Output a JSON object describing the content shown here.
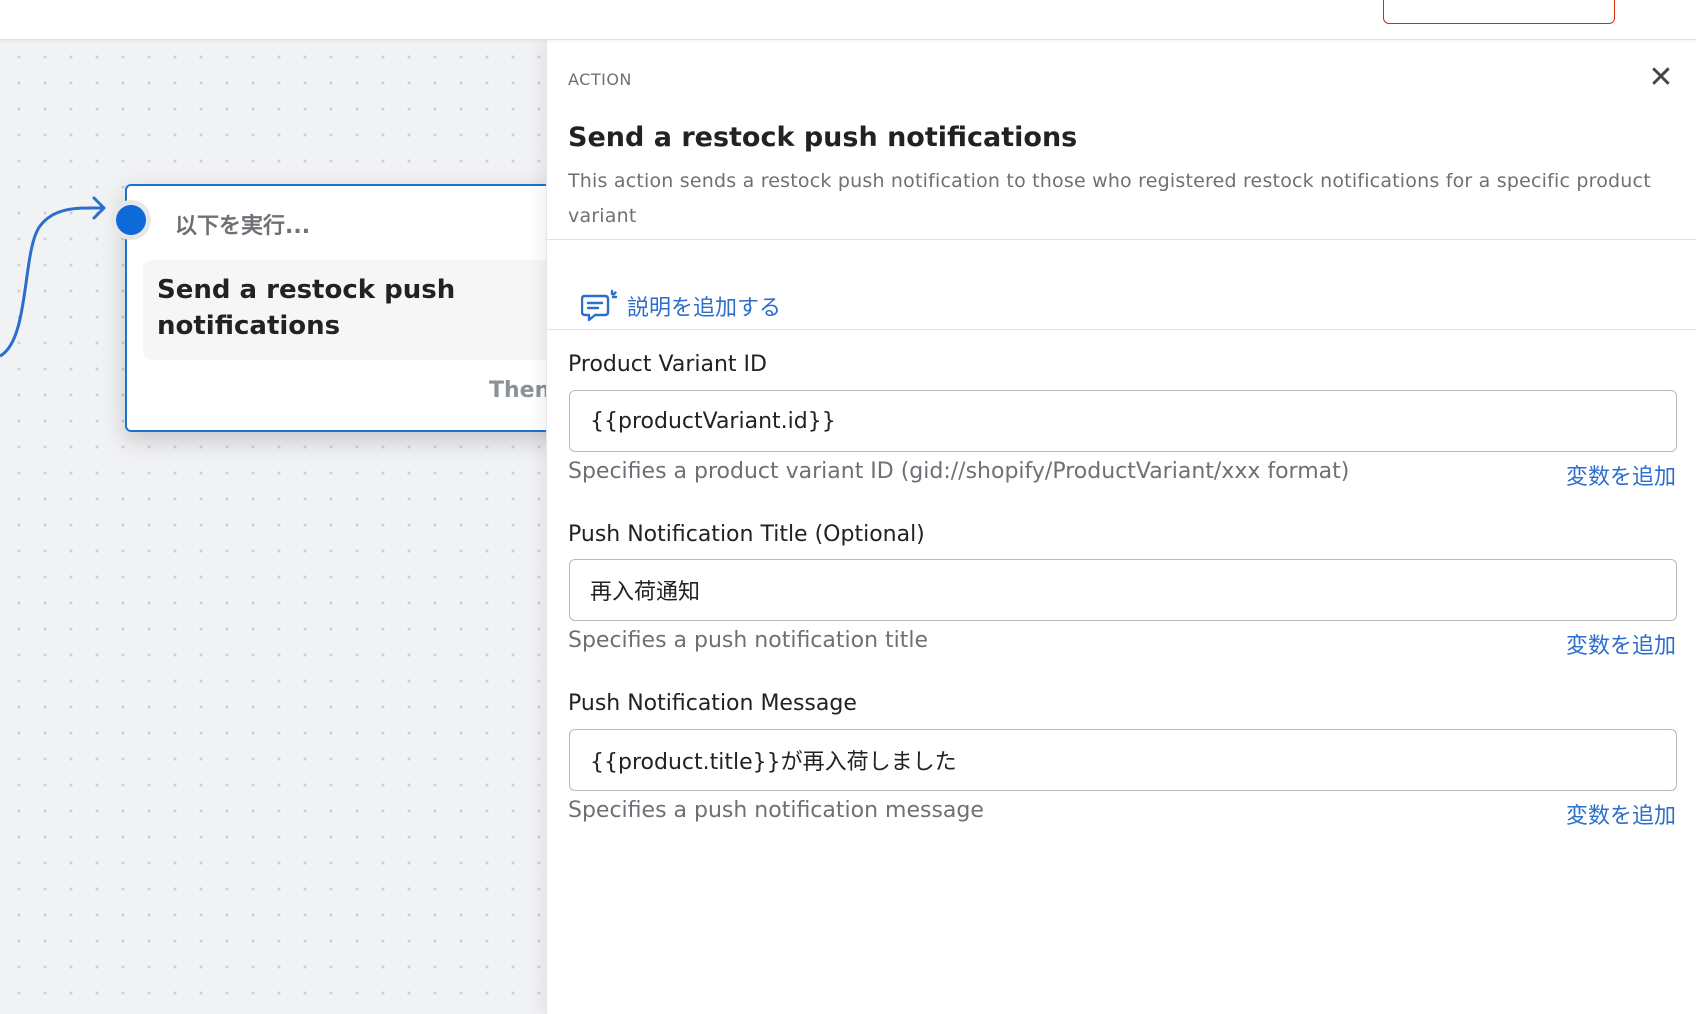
{
  "topbar": {
    "action_label": ""
  },
  "canvas": {
    "node": {
      "trigger_label": "以下を実行...",
      "title": "Send a restock push notifications",
      "then_label": "Then"
    }
  },
  "panel": {
    "eyebrow": "ACTION",
    "close_symbol": "✕",
    "title": "Send a restock push notifications",
    "description": "This action sends a restock push notification to those who registered restock notifications for a specific product variant",
    "add_description_label": "説明を追加する",
    "fields": [
      {
        "label": "Product Variant ID",
        "value": "{{productVariant.id}}",
        "help": "Specifies a product variant ID (gid://shopify/ProductVariant/xxx format)",
        "add_variable": "変数を追加"
      },
      {
        "label": "Push Notification Title (Optional)",
        "value": "再入荷通知",
        "help": "Specifies a push notification title",
        "add_variable": "変数を追加"
      },
      {
        "label": "Push Notification Message",
        "value": "{{product.title}}が再入荷しました",
        "help": "Specifies a push notification message",
        "add_variable": "変数を追加"
      }
    ]
  },
  "colors": {
    "accent_blue": "#2c6ecb",
    "node_border": "#1a73c8",
    "danger": "#d72c0d"
  },
  "icons": [
    "connector-arrow-icon",
    "close-icon",
    "add-description-icon"
  ]
}
